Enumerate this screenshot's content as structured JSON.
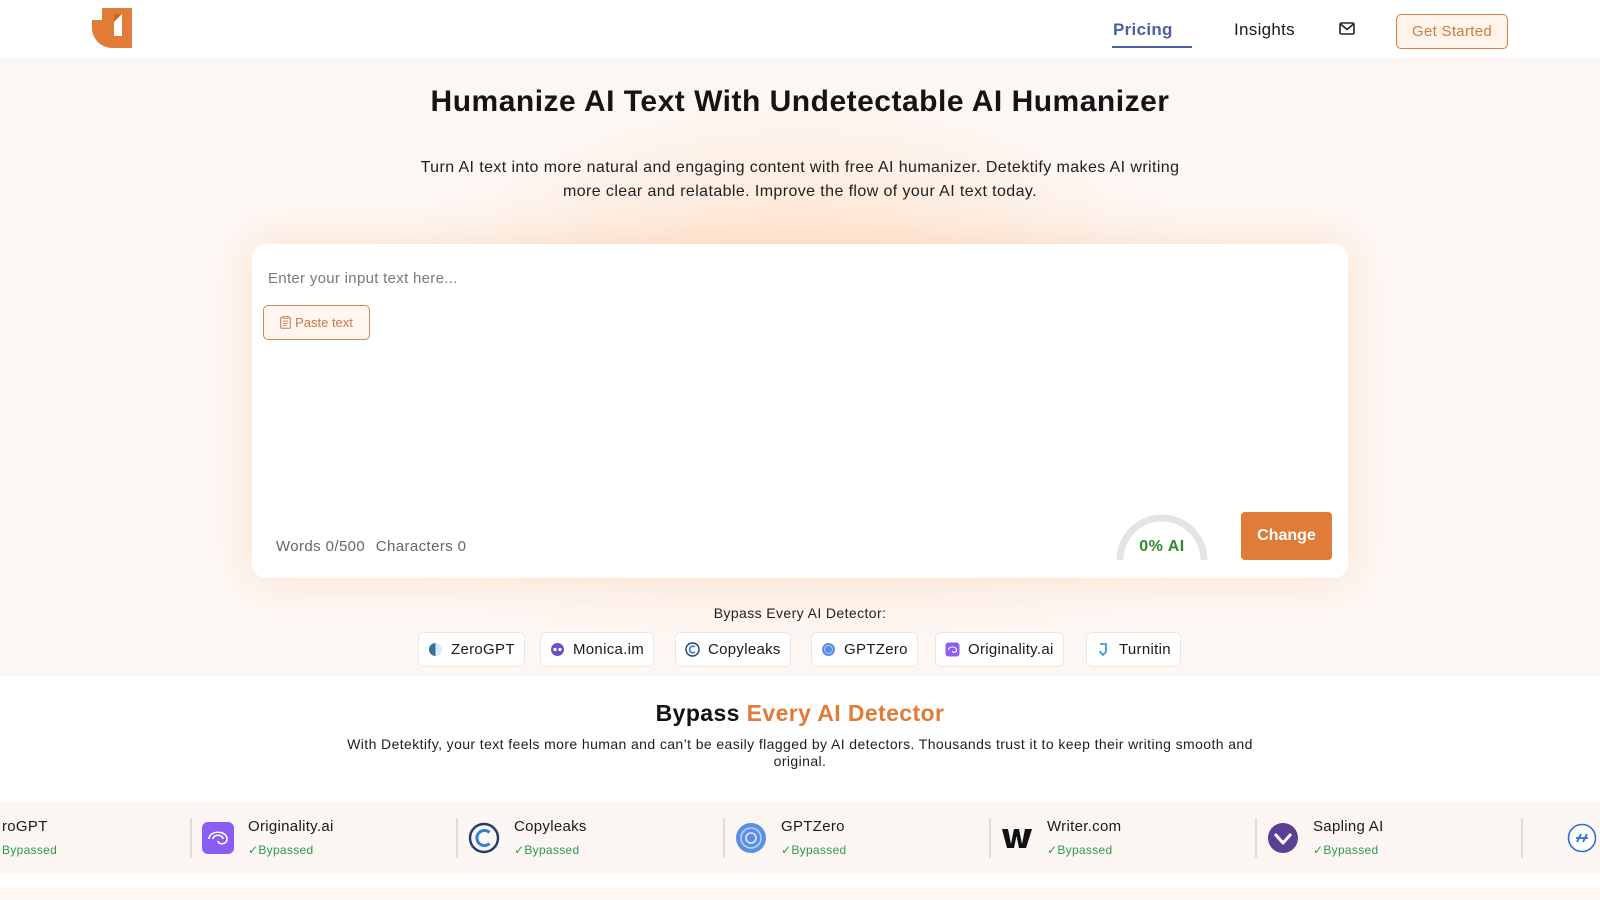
{
  "header": {
    "nav": [
      {
        "label": "Pricing",
        "active": true
      },
      {
        "label": "Insights",
        "active": false
      }
    ],
    "cta": "Get Started",
    "brand_color": "#e07c37",
    "active_nav_color": "#4a5fa8"
  },
  "hero": {
    "title": "Humanize AI Text With Undetectable AI Humanizer",
    "subtitle": "Turn AI text into more natural and engaging content with free AI humanizer. Detektify makes AI writing more clear and relatable. Improve the flow of your AI text today."
  },
  "editor": {
    "placeholder": "Enter your input text here...",
    "paste_label": "Paste text",
    "words_label": "Words 0/500",
    "chars_label": "Characters 0",
    "ai_score_label": "0% AI",
    "ai_score": 0,
    "change_label": "Change"
  },
  "detectors_bar": {
    "label": "Bypass Every AI Detector:",
    "chips": [
      {
        "name": "ZeroGPT",
        "icon": "zerogpt-icon"
      },
      {
        "name": "Monica.im",
        "icon": "monica-icon"
      },
      {
        "name": "Copyleaks",
        "icon": "copyleaks-icon"
      },
      {
        "name": "GPTZero",
        "icon": "gptzero-icon"
      },
      {
        "name": "Originality.ai",
        "icon": "originality-icon"
      },
      {
        "name": "Turnitin",
        "icon": "turnitin-icon"
      }
    ]
  },
  "section2": {
    "title_plain": "Bypass ",
    "title_accent": "Every AI Detector",
    "subtitle": "With Detektify, your text feels more human and can’t be easily flagged by AI detectors. Thousands trust it to keep their writing smooth and original."
  },
  "marquee": {
    "status_label": "Bypassed",
    "items": [
      {
        "name": "roGPT"
      },
      {
        "name": "Originality.ai"
      },
      {
        "name": "Copyleaks"
      },
      {
        "name": "GPTZero"
      },
      {
        "name": "Writer.com"
      },
      {
        "name": "Sapling AI"
      },
      {
        "name": ""
      }
    ]
  }
}
